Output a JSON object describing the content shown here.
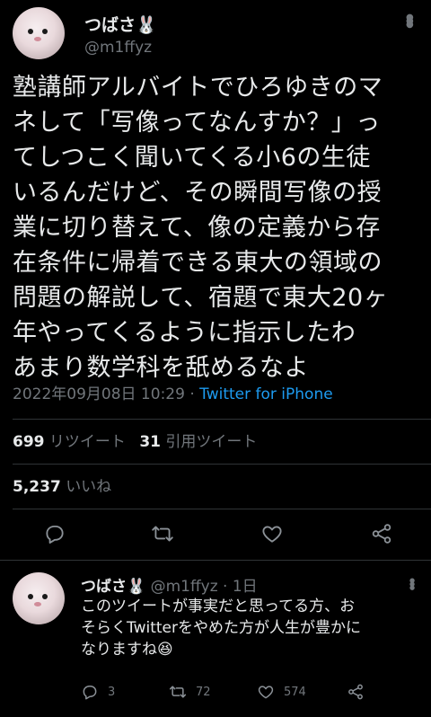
{
  "main_tweet": {
    "author_name": "つばさ🐰",
    "handle": "@m1ffyz",
    "text_lines": [
      "塾講師アルバイトでひろゆきのマ",
      "ネして「写像ってなんすか？」っ",
      "てしつこく聞いてくる小6の生徒",
      "いるんだけど、その瞬間写像の授",
      "業に切り替えて、像の定義から存",
      "在条件に帰着できる東大の領域の",
      "問題の解説して、宿題で東大20ヶ",
      "年やってくるように指示したわ",
      "あまり数学科を舐めるなよ"
    ],
    "timestamp": "2022年09月08日 10:29 · ",
    "source": "Twitter for iPhone",
    "retweets_count": "699",
    "retweets_label": "リツイート",
    "quotes_count": "31",
    "quotes_label": "引用ツイート",
    "likes_count": "5,237",
    "likes_label": "いいね"
  },
  "reply": {
    "author_name": "つばさ🐰",
    "handle": "@m1ffyz · 1日",
    "text_lines": [
      "このツイートが事実だと思ってる方、お",
      "そらくTwitterをやめた方が人生が豊かに",
      "なりますね😆"
    ],
    "replies": "3",
    "retweets": "72",
    "likes": "574"
  },
  "colors": {
    "background": "#000000",
    "text": "#e7e9ea",
    "secondary": "#71767b",
    "link": "#1d9bf0",
    "divider": "#2f3336"
  }
}
